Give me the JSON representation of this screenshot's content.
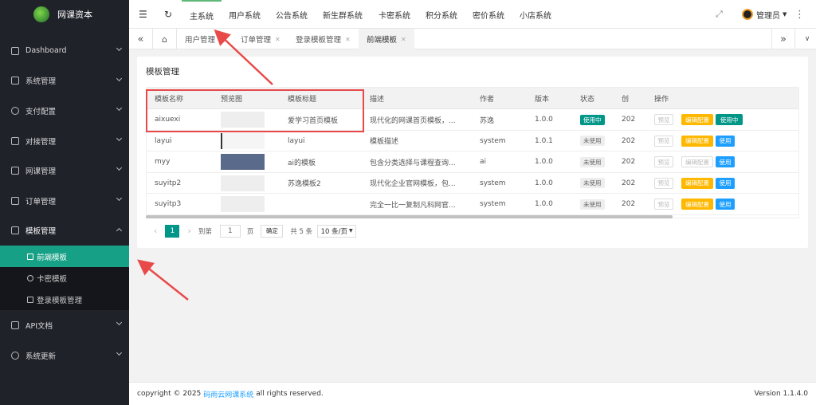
{
  "brand": {
    "name": "网课资本"
  },
  "sidebar": {
    "items": [
      {
        "label": "Dashboard",
        "icon": "dashboard-icon"
      },
      {
        "label": "系统管理",
        "icon": "cube-icon"
      },
      {
        "label": "支付配置",
        "icon": "currency-icon"
      },
      {
        "label": "对接管理",
        "icon": "link-icon"
      },
      {
        "label": "网课管理",
        "icon": "book-icon"
      },
      {
        "label": "订单管理",
        "icon": "cart-icon"
      },
      {
        "label": "模板管理",
        "icon": "template-icon"
      },
      {
        "label": "API文档",
        "icon": "doc-icon"
      },
      {
        "label": "系统更新",
        "icon": "refresh-icon"
      }
    ],
    "sub": [
      {
        "label": "前端模板"
      },
      {
        "label": "卡密模板"
      },
      {
        "label": "登录模板管理"
      }
    ]
  },
  "header": {
    "nav": [
      "主系统",
      "用户系统",
      "公告系统",
      "新生群系统",
      "卡密系统",
      "积分系统",
      "密价系统",
      "小店系统"
    ],
    "user": "管理员"
  },
  "tabs": [
    "用户管理",
    "订单管理",
    "登录模板管理",
    "前端模板"
  ],
  "card": {
    "title": "模板管理"
  },
  "table": {
    "headers": [
      "模板名称",
      "预览图",
      "模板标题",
      "描述",
      "作者",
      "版本",
      "状态",
      "创",
      "操作"
    ],
    "rows": [
      {
        "name": "aixuexi",
        "title": "爱学习首页模板",
        "desc": "现代化的网课首页模板，...",
        "author": "苏逸",
        "version": "1.0.0",
        "status": "使用中",
        "created": "202",
        "ops": [
          "预览",
          "编辑配置",
          "使用中"
        ]
      },
      {
        "name": "layui",
        "title": "layui",
        "desc": "模板描述",
        "author": "system",
        "version": "1.0.1",
        "status": "未使用",
        "created": "202",
        "ops": [
          "预览",
          "编辑配置",
          "使用"
        ]
      },
      {
        "name": "myy",
        "title": "ai的模板",
        "desc": "包含分类选择与课程查询...",
        "author": "ai",
        "version": "1.0.0",
        "status": "未使用",
        "created": "202",
        "ops": [
          "预览",
          "编辑配置",
          "使用"
        ]
      },
      {
        "name": "suyitp2",
        "title": "苏逸模板2",
        "desc": "现代化企业官网模板，包...",
        "author": "system",
        "version": "1.0.0",
        "status": "未使用",
        "created": "202",
        "ops": [
          "预览",
          "编辑配置",
          "使用"
        ]
      },
      {
        "name": "suyitp3",
        "title": "",
        "desc": "完全一比一复制凡科网官...",
        "author": "system",
        "version": "1.0.0",
        "status": "未使用",
        "created": "202",
        "ops": [
          "预览",
          "编辑配置",
          "使用"
        ]
      }
    ]
  },
  "pager": {
    "current": "1",
    "goto_label": "到第",
    "page_input": "1",
    "page_suffix": "页",
    "confirm": "确定",
    "total": "共 5 条",
    "per_page": "10 条/页"
  },
  "footer": {
    "copyright_prefix": "copyright © 2025",
    "link": "码雨云网课系统",
    "copyright_suffix": "all rights reserved.",
    "version": "Version 1.1.4.0"
  },
  "colors": {
    "sidebar_bg": "#20222a",
    "active": "#16a085",
    "orange": "#ffb800",
    "blue": "#1e9fff",
    "green": "#009688",
    "highlight": "#e84a4a"
  }
}
